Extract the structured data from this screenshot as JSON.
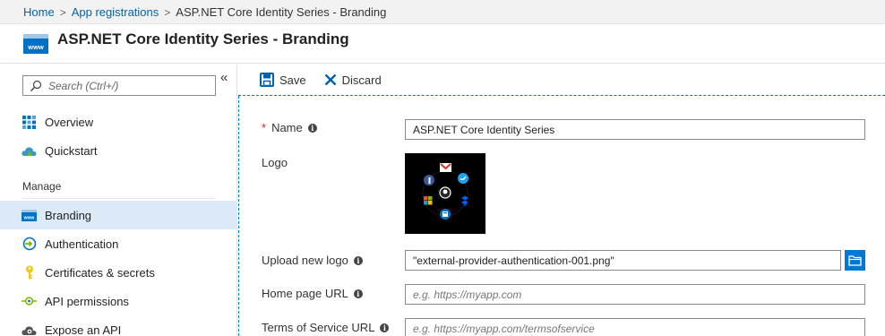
{
  "breadcrumb": {
    "home": "Home",
    "app_registrations": "App registrations",
    "current": "ASP.NET Core Identity Series - Branding",
    "separator": ">"
  },
  "header": {
    "title": "ASP.NET Core Identity Series - Branding",
    "icon": "www-icon"
  },
  "sidebar": {
    "collapse_glyph": "«",
    "search_placeholder": "Search (Ctrl+/)",
    "items_top": [
      {
        "label": "Overview",
        "icon": "grid-icon"
      },
      {
        "label": "Quickstart",
        "icon": "cloud-icon"
      }
    ],
    "section_label": "Manage",
    "items_manage": [
      {
        "label": "Branding",
        "icon": "www-icon",
        "active": true
      },
      {
        "label": "Authentication",
        "icon": "authentication-icon"
      },
      {
        "label": "Certificates & secrets",
        "icon": "key-icon"
      },
      {
        "label": "API permissions",
        "icon": "api-permissions-icon"
      },
      {
        "label": "Expose an API",
        "icon": "cloud-gear-icon"
      }
    ]
  },
  "toolbar": {
    "save_label": "Save",
    "discard_label": "Discard"
  },
  "form": {
    "name": {
      "label": "Name",
      "required_mark": "*",
      "value": "ASP.NET Core Identity Series"
    },
    "logo": {
      "label": "Logo"
    },
    "upload": {
      "label": "Upload new logo",
      "value": "\"external-provider-authentication-001.png\""
    },
    "home_page_url": {
      "label": "Home page URL",
      "placeholder": "e.g. https://myapp.com"
    },
    "terms_url": {
      "label": "Terms of Service URL",
      "placeholder": "e.g. https://myapp.com/termsofservice"
    },
    "info_glyph": "i"
  },
  "colors": {
    "accent": "#0078d4",
    "link": "#0062b0",
    "active_bg": "#dceaf7",
    "required": "#c4262e"
  }
}
